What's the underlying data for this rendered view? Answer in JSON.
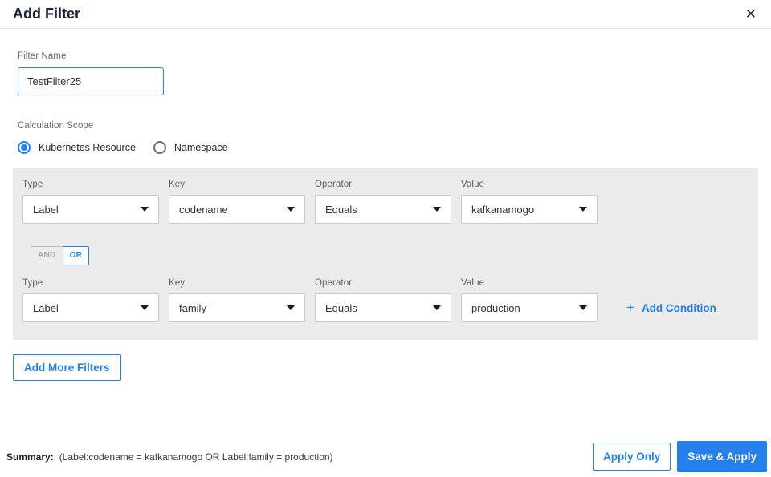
{
  "header": {
    "title": "Add Filter",
    "close_icon": "✕"
  },
  "filter_name": {
    "label": "Filter Name",
    "value": "TestFilter25"
  },
  "calculation_scope": {
    "label": "Calculation Scope",
    "options": [
      {
        "label": "Kubernetes Resource",
        "selected": true
      },
      {
        "label": "Namespace",
        "selected": false
      }
    ]
  },
  "conditions": {
    "columns": [
      "Type",
      "Key",
      "Operator",
      "Value"
    ],
    "rows": [
      {
        "type": "Label",
        "key": "codename",
        "operator": "Equals",
        "value": "kafkanamogo"
      },
      {
        "type": "Label",
        "key": "family",
        "operator": "Equals",
        "value": "production"
      }
    ],
    "logic_toggle": {
      "and_label": "AND",
      "or_label": "OR",
      "selected": "OR"
    },
    "add_condition": {
      "plus_icon": "+",
      "label": "Add Condition"
    }
  },
  "add_more_filters_label": "Add More Filters",
  "footer": {
    "summary_label": "Summary:",
    "summary_value": "(Label:codename = kafkanamogo OR Label:family = production)",
    "apply_only_label": "Apply Only",
    "save_apply_label": "Save & Apply"
  },
  "colors": {
    "accent_blue": "#2680eb",
    "panel_gray": "#ebebeb"
  }
}
